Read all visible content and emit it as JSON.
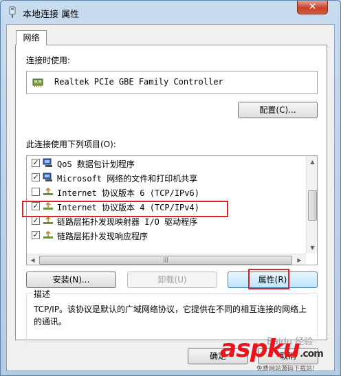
{
  "window": {
    "title": "本地连接 属性",
    "close_label": "✕"
  },
  "tabs": [
    {
      "label": "网络"
    }
  ],
  "connect_using": {
    "label": "连接时使用:",
    "adapter": "Realtek PCIe GBE Family Controller",
    "configure_label": "配置(C)..."
  },
  "items_section": {
    "label": "此连接使用下列项目(O):",
    "items": [
      {
        "label": "QoS 数据包计划程序",
        "checked": true,
        "icon": "network-service-icon"
      },
      {
        "label": "Microsoft 网络的文件和打印机共享",
        "checked": true,
        "icon": "network-service-icon"
      },
      {
        "label": "Internet 协议版本 6 (TCP/IPv6)",
        "checked": false,
        "icon": "protocol-icon"
      },
      {
        "label": "Internet 协议版本 4 (TCP/IPv4)",
        "checked": true,
        "icon": "protocol-icon"
      },
      {
        "label": "链路层拓扑发现映射器 I/O 驱动程序",
        "checked": true,
        "icon": "protocol-icon"
      },
      {
        "label": "链路层拓扑发现响应程序",
        "checked": true,
        "icon": "protocol-icon"
      }
    ]
  },
  "buttons": {
    "install": "安装(N)...",
    "uninstall": "卸载(U)",
    "properties": "属性(R)",
    "ok": "确定",
    "cancel": "取消"
  },
  "description": {
    "title": "描述",
    "text": "TCP/IP。该协议是默认的广域网络协议，它提供在不同的相互连接的网络上的通讯。"
  },
  "watermark": {
    "brand": "aspku",
    "domain": ".com",
    "tagline": "免费网站源码下载站！",
    "baidu": "Baidu 经验"
  },
  "colors": {
    "highlight": "#d9222a",
    "brand_red": "#e8161c"
  }
}
